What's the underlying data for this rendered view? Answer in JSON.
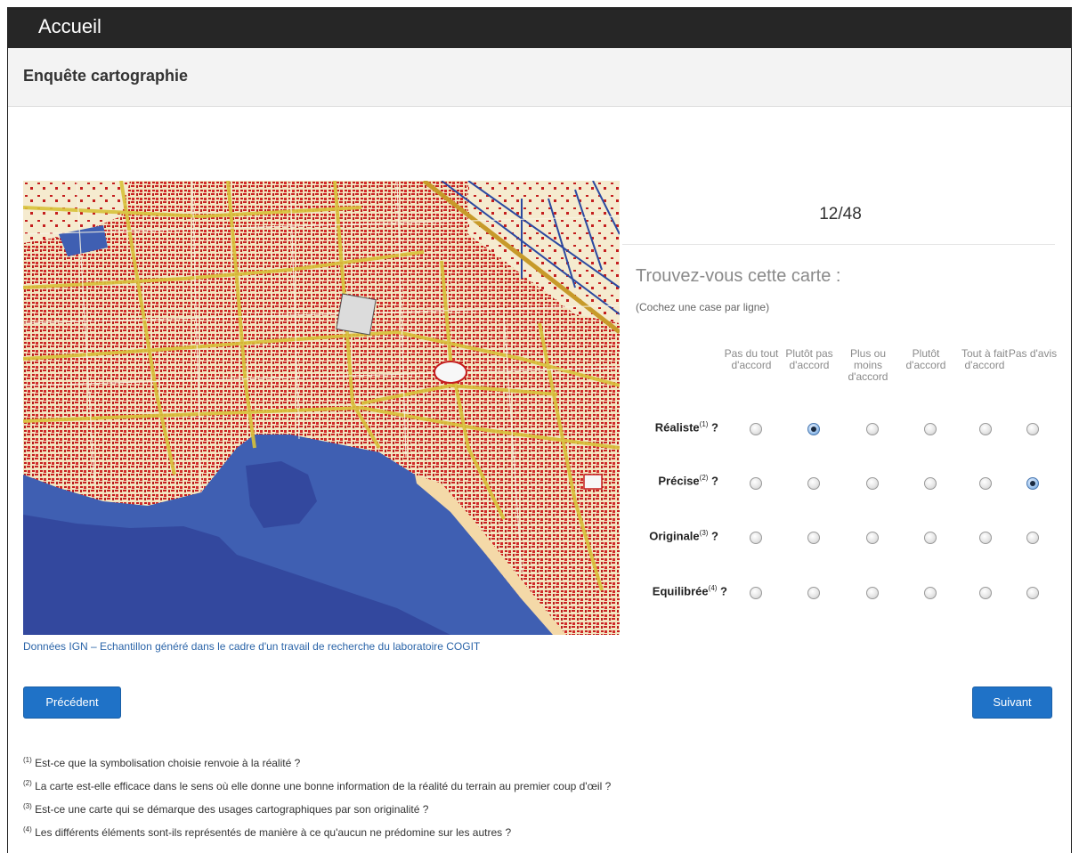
{
  "nav": {
    "brand": "Accueil"
  },
  "panel": {
    "title": "Enquête cartographie"
  },
  "map": {
    "credits": "Données IGN – Echantillon généré dans le cadre d'un travail de recherche du laboratoire COGIT"
  },
  "survey": {
    "counter": "12/48",
    "question": "Trouvez-vous cette carte :",
    "instruction": "(Cochez une case par ligne)",
    "columns": [
      "Pas du tout d'accord",
      "Plutôt pas d'accord",
      "Plus ou moins d'accord",
      "Plutôt d'accord",
      "Tout à fait d'accord",
      "Pas d'avis"
    ],
    "rows": [
      {
        "label": "Réaliste",
        "note": "(1)",
        "suffix": " ?",
        "selected": 1
      },
      {
        "label": "Précise",
        "note": "(2)",
        "suffix": " ?",
        "selected": 5
      },
      {
        "label": "Originale",
        "note": "(3)",
        "suffix": " ?",
        "selected": null
      },
      {
        "label": "Equilibrée",
        "note": "(4)",
        "suffix": " ?",
        "selected": null
      }
    ]
  },
  "buttons": {
    "previous": "Précédent",
    "next": "Suivant"
  },
  "footnotes": [
    {
      "mark": "(1)",
      "text": "Est-ce que la symbolisation choisie renvoie à la réalité ?"
    },
    {
      "mark": "(2)",
      "text": "La carte est-elle efficace dans le sens où elle donne une bonne information de la réalité du terrain au premier coup d'œil ?"
    },
    {
      "mark": "(3)",
      "text": "Est-ce une carte qui se démarque des usages cartographiques par son originalité ?"
    },
    {
      "mark": "(4)",
      "text": "Les différents éléments sont-ils représentés de manière à ce qu'aucun ne prédomine sur les autres ?"
    }
  ]
}
